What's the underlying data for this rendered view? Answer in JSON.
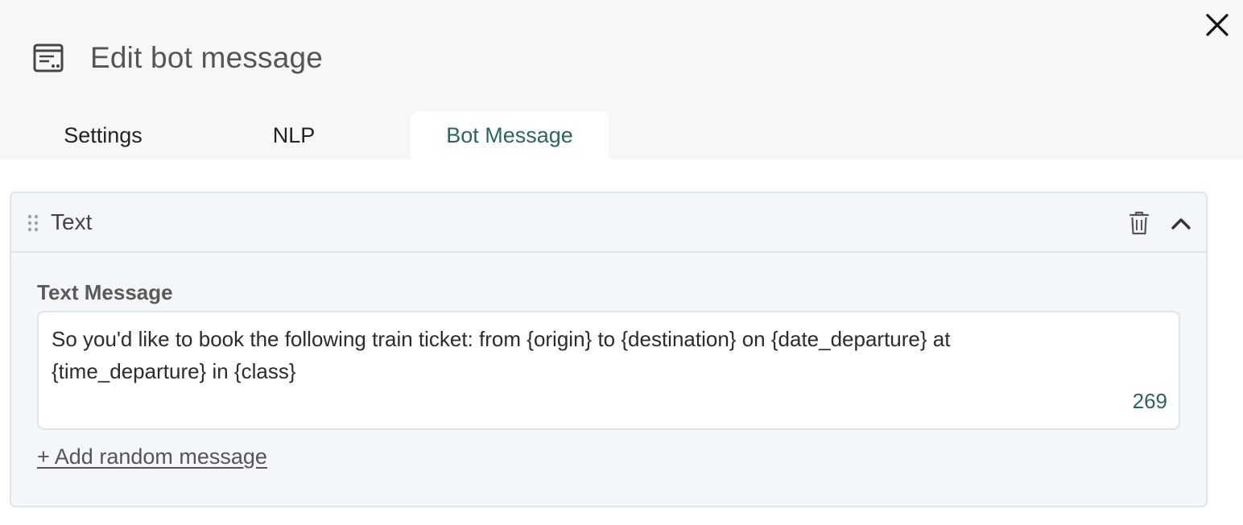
{
  "dialog": {
    "title": "Edit bot message",
    "icon": "bot-message-icon",
    "close_icon": "close-icon"
  },
  "tabs": [
    {
      "label": "Settings",
      "active": false
    },
    {
      "label": "NLP",
      "active": false
    },
    {
      "label": "Bot Message",
      "active": true
    }
  ],
  "block": {
    "title": "Text",
    "drag_icon": "drag-handle-icon",
    "delete_icon": "trash-icon",
    "collapse_icon": "chevron-up-icon",
    "field_label": "Text Message",
    "message": "So you'd like to book the following train ticket: from {origin} to {destination} on {date_departure} at\n{time_departure} in {class}",
    "char_count": "269",
    "add_link": "+ Add random message"
  },
  "colors": {
    "accent": "#2d6460",
    "header_bg": "#f7f7f7",
    "card_bg": "#f3f7fa",
    "border": "#dde5ea"
  }
}
